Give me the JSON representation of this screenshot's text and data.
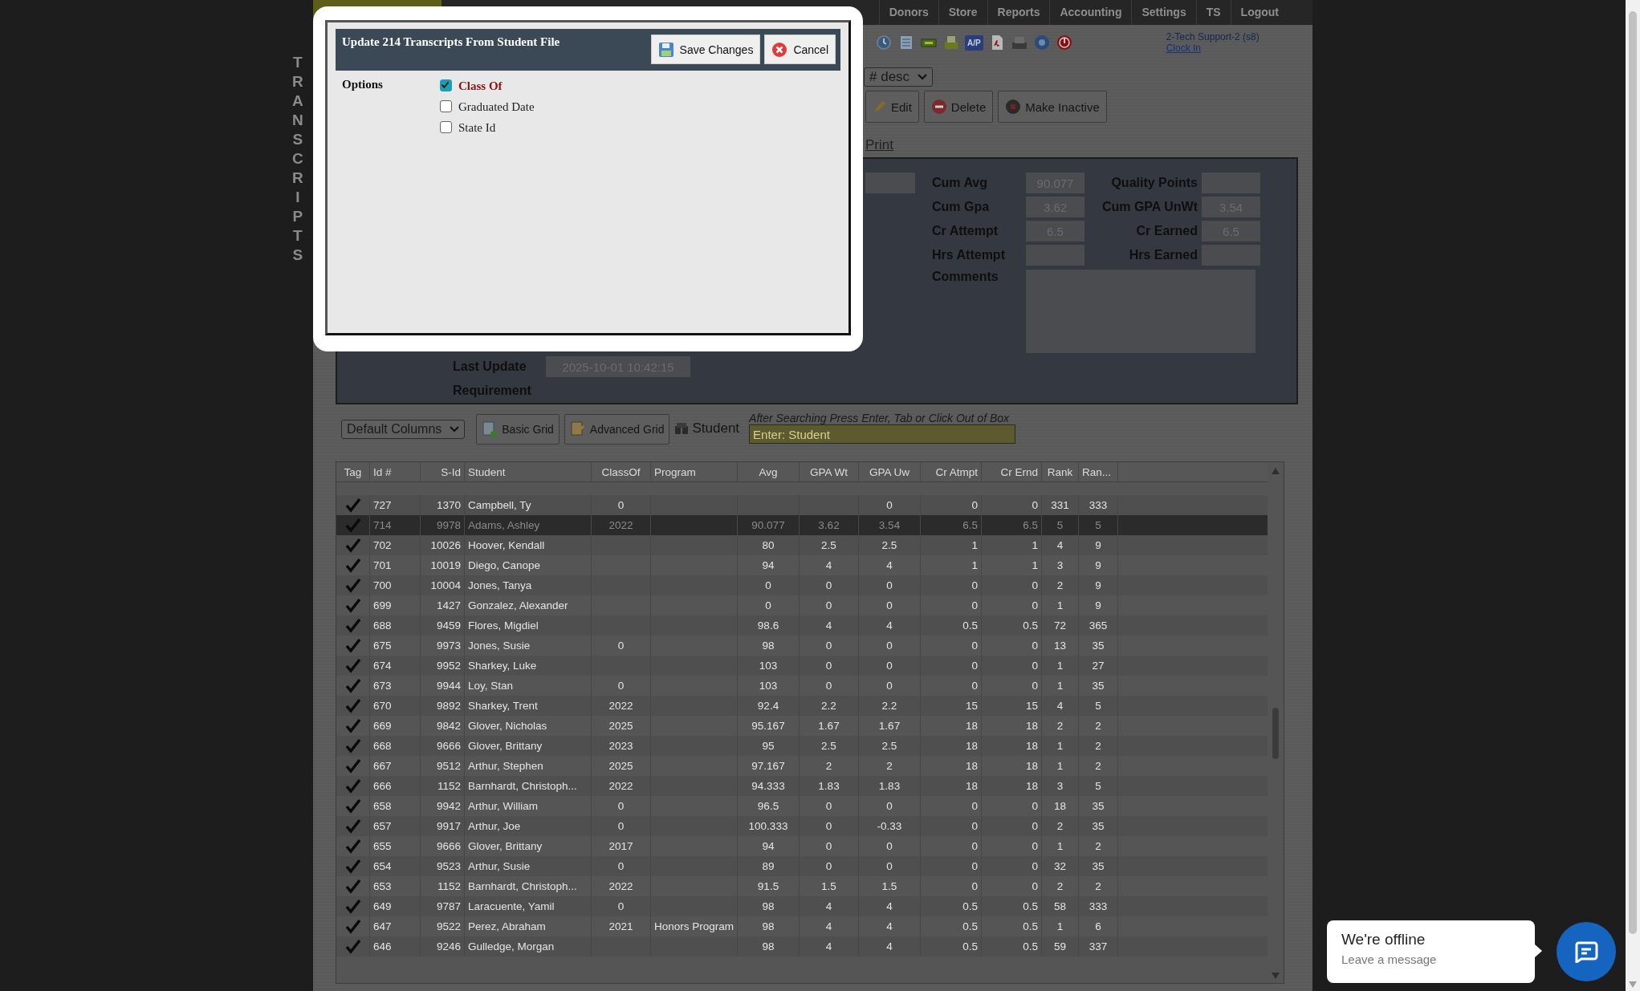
{
  "sidebar_title": "TRANSCRIPTS",
  "nav": [
    "Donors",
    "Store",
    "Reports",
    "Accounting",
    "Settings",
    "TS",
    "Logout"
  ],
  "toolbar": {
    "ap_label": "A/P",
    "user": "2-Tech Support-2 (s8)",
    "clock_in": "Clock In"
  },
  "sort_select": "# desc",
  "actions": [
    {
      "label": "Edit",
      "kind": "edit"
    },
    {
      "label": "Delete",
      "kind": "delete"
    },
    {
      "label": "Make Inactive",
      "kind": "inactive"
    }
  ],
  "print_link": "Print",
  "summary": {
    "stats": [
      {
        "label": "Cum Avg",
        "value": "90.077",
        "right_label": "Quality Points"
      },
      {
        "label": "Cum Gpa",
        "value": "3.62",
        "right_label": "Cum GPA UnWt",
        "right_value": "3.54"
      },
      {
        "label": "Cr Attempt",
        "value": "6.5",
        "right_label": "Cr Earned",
        "right_value": "6.5"
      },
      {
        "label": "Hrs Attempt",
        "right_label": "Hrs Earned"
      }
    ],
    "comments_label": "Comments",
    "last_update": {
      "label": "Last Update",
      "value": "2025-10-01 10:42:15"
    },
    "requirement_label": "Requirement"
  },
  "grid_toolbar": {
    "columns_select": "Default Columns",
    "buttons": [
      {
        "label": "Basic Grid",
        "kind": "basic"
      },
      {
        "label": "Advanced Grid",
        "kind": "advanced"
      }
    ],
    "student_label": "Student",
    "hint": "After Searching Press Enter, Tab or Click Out of Box",
    "search_placeholder": "Enter: Student"
  },
  "table": {
    "columns": [
      "Tag",
      "Id #",
      "S-Id",
      "Student",
      "ClassOf",
      "Program",
      "Avg",
      "GPA Wt",
      "GPA Uw",
      "Cr Atmpt",
      "Cr Ernd",
      "Rank",
      "Ran..."
    ],
    "rows": [
      {
        "tagged": true,
        "selected": false,
        "cells": [
          null,
          "727",
          "1370",
          "Campbell, Ty",
          "0",
          null,
          null,
          null,
          "0",
          "0",
          "0",
          "331",
          "333"
        ]
      },
      {
        "tagged": true,
        "selected": true,
        "cells": [
          null,
          "714",
          "9978",
          "Adams, Ashley",
          "2022",
          null,
          "90.077",
          "3.62",
          "3.54",
          "6.5",
          "6.5",
          "5",
          "5"
        ]
      },
      {
        "tagged": true,
        "selected": false,
        "cells": [
          null,
          "702",
          "10026",
          "Hoover, Kendall",
          null,
          null,
          "80",
          "2.5",
          "2.5",
          "1",
          "1",
          "4",
          "9"
        ]
      },
      {
        "tagged": true,
        "selected": false,
        "cells": [
          null,
          "701",
          "10019",
          "Diego, Canope",
          null,
          null,
          "94",
          "4",
          "4",
          "1",
          "1",
          "3",
          "9"
        ]
      },
      {
        "tagged": true,
        "selected": false,
        "cells": [
          null,
          "700",
          "10004",
          "Jones, Tanya",
          null,
          null,
          "0",
          "0",
          "0",
          "0",
          "0",
          "2",
          "9"
        ]
      },
      {
        "tagged": true,
        "selected": false,
        "cells": [
          null,
          "699",
          "1427",
          "Gonzalez, Alexander",
          null,
          null,
          "0",
          "0",
          "0",
          "0",
          "0",
          "1",
          "9"
        ]
      },
      {
        "tagged": true,
        "selected": false,
        "cells": [
          null,
          "688",
          "9459",
          "Flores, Migdiel",
          null,
          null,
          "98.6",
          "4",
          "4",
          "0.5",
          "0.5",
          "72",
          "365"
        ]
      },
      {
        "tagged": true,
        "selected": false,
        "cells": [
          null,
          "675",
          "9973",
          "Jones, Susie",
          "0",
          null,
          "98",
          "0",
          "0",
          "0",
          "0",
          "13",
          "35"
        ]
      },
      {
        "tagged": true,
        "selected": false,
        "cells": [
          null,
          "674",
          "9952",
          "Sharkey, Luke",
          null,
          null,
          "103",
          "0",
          "0",
          "0",
          "0",
          "1",
          "27"
        ]
      },
      {
        "tagged": true,
        "selected": false,
        "cells": [
          null,
          "673",
          "9944",
          "Loy, Stan",
          "0",
          null,
          "103",
          "0",
          "0",
          "0",
          "0",
          "1",
          "35"
        ]
      },
      {
        "tagged": true,
        "selected": false,
        "cells": [
          null,
          "670",
          "9892",
          "Sharkey, Trent",
          "2022",
          null,
          "92.4",
          "2.2",
          "2.2",
          "15",
          "15",
          "4",
          "5"
        ]
      },
      {
        "tagged": true,
        "selected": false,
        "cells": [
          null,
          "669",
          "9842",
          "Glover, Nicholas",
          "2025",
          null,
          "95.167",
          "1.67",
          "1.67",
          "18",
          "18",
          "2",
          "2"
        ]
      },
      {
        "tagged": true,
        "selected": false,
        "cells": [
          null,
          "668",
          "9666",
          "Glover, Brittany",
          "2023",
          null,
          "95",
          "2.5",
          "2.5",
          "18",
          "18",
          "1",
          "2"
        ]
      },
      {
        "tagged": true,
        "selected": false,
        "cells": [
          null,
          "667",
          "9512",
          "Arthur, Stephen",
          "2025",
          null,
          "97.167",
          "2",
          "2",
          "18",
          "18",
          "1",
          "2"
        ]
      },
      {
        "tagged": true,
        "selected": false,
        "cells": [
          null,
          "666",
          "1152",
          "Barnhardt, Christoph...",
          "2022",
          null,
          "94.333",
          "1.83",
          "1.83",
          "18",
          "18",
          "3",
          "5"
        ]
      },
      {
        "tagged": true,
        "selected": false,
        "cells": [
          null,
          "658",
          "9942",
          "Arthur, William",
          "0",
          null,
          "96.5",
          "0",
          "0",
          "0",
          "0",
          "18",
          "35"
        ]
      },
      {
        "tagged": true,
        "selected": false,
        "cells": [
          null,
          "657",
          "9917",
          "Arthur, Joe",
          "0",
          null,
          "100.333",
          "0",
          "-0.33",
          "0",
          "0",
          "2",
          "35"
        ]
      },
      {
        "tagged": true,
        "selected": false,
        "cells": [
          null,
          "655",
          "9666",
          "Glover, Brittany",
          "2017",
          null,
          "94",
          "0",
          "0",
          "0",
          "0",
          "1",
          "2"
        ]
      },
      {
        "tagged": true,
        "selected": false,
        "cells": [
          null,
          "654",
          "9523",
          "Arthur, Susie",
          "0",
          null,
          "89",
          "0",
          "0",
          "0",
          "0",
          "32",
          "35"
        ]
      },
      {
        "tagged": true,
        "selected": false,
        "cells": [
          null,
          "653",
          "1152",
          "Barnhardt, Christoph...",
          "2022",
          null,
          "91.5",
          "1.5",
          "1.5",
          "0",
          "0",
          "2",
          "2"
        ]
      },
      {
        "tagged": true,
        "selected": false,
        "cells": [
          null,
          "649",
          "9787",
          "Laracuente, Yamil",
          "0",
          null,
          "98",
          "4",
          "4",
          "0.5",
          "0.5",
          "58",
          "333"
        ]
      },
      {
        "tagged": true,
        "selected": false,
        "cells": [
          null,
          "647",
          "9522",
          "Perez, Abraham",
          "2021",
          "Honors Program",
          "98",
          "4",
          "4",
          "0.5",
          "0.5",
          "1",
          "6"
        ]
      },
      {
        "tagged": true,
        "selected": false,
        "cells": [
          null,
          "646",
          "9246",
          "Gulledge, Morgan",
          null,
          null,
          "98",
          "4",
          "4",
          "0.5",
          "0.5",
          "59",
          "337"
        ]
      }
    ]
  },
  "modal": {
    "title": "Update 214 Transcripts From Student File",
    "buttons": [
      {
        "label": "Save Changes",
        "kind": "save"
      },
      {
        "label": "Cancel",
        "kind": "cancel"
      }
    ],
    "options_label": "Options",
    "options": [
      {
        "label": "Class Of",
        "checked": true
      },
      {
        "label": "Graduated Date",
        "checked": false
      },
      {
        "label": "State Id",
        "checked": false
      }
    ]
  },
  "chat": {
    "title": "We're offline",
    "subtitle": "Leave a message"
  }
}
